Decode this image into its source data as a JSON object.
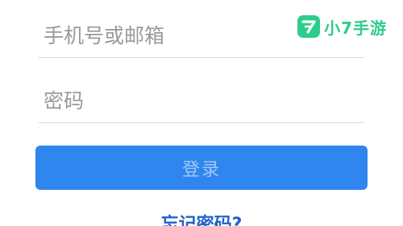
{
  "form": {
    "phone_placeholder": "手机号或邮箱",
    "password_placeholder": "密码",
    "login_label": "登录",
    "forgot_label": "忘记密码?"
  },
  "watermark": {
    "logo_icon": "seven-logo-icon",
    "text": "小7手游"
  },
  "colors": {
    "button": "#2f86ef",
    "link": "#1f64c8",
    "watermark": "#2ecc8a"
  }
}
